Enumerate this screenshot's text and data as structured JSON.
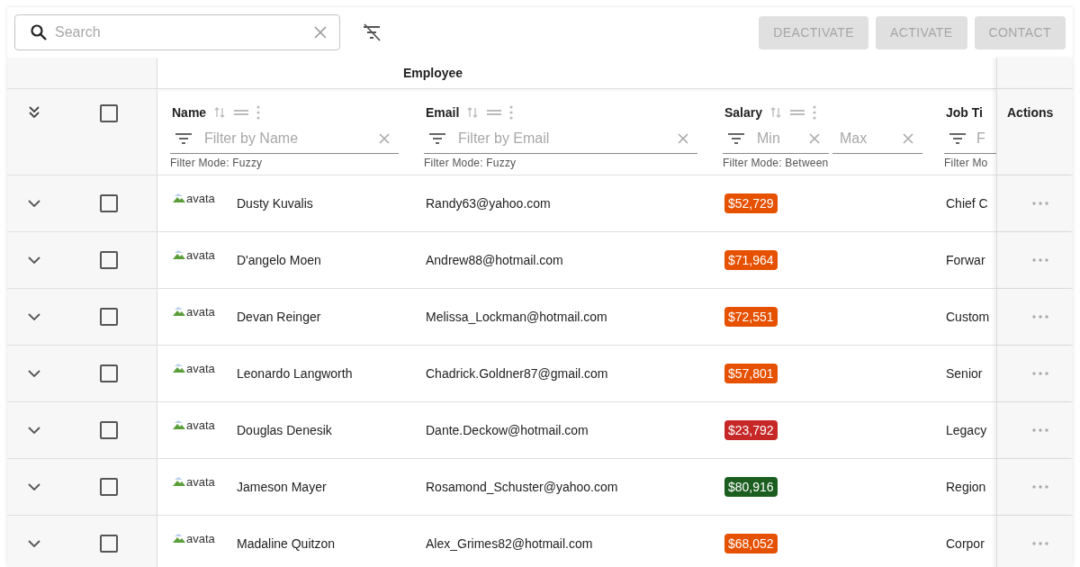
{
  "search": {
    "placeholder": "Search"
  },
  "toolbar_buttons": [
    {
      "label": "DEACTIVATE",
      "disabled": true
    },
    {
      "label": "ACTIVATE",
      "disabled": true
    },
    {
      "label": "CONTACT",
      "disabled": true
    }
  ],
  "column_group": {
    "label": "Employee"
  },
  "columns": [
    {
      "kind": "text",
      "label": "Name",
      "filter_placeholder": "Filter by Name",
      "filter_mode": "Filter Mode: Fuzzy"
    },
    {
      "kind": "text",
      "label": "Email",
      "filter_placeholder": "Filter by Email",
      "filter_mode": "Filter Mode: Fuzzy"
    },
    {
      "kind": "range",
      "label": "Salary",
      "min_placeholder": "Min",
      "max_placeholder": "Max",
      "filter_mode": "Filter Mode: Between"
    },
    {
      "kind": "covered",
      "label": "Job Ti",
      "filter_placeholder": "F",
      "filter_mode": "Filter Mo"
    }
  ],
  "actions_header": "Actions",
  "select_all": {
    "checked": false
  },
  "rows": [
    {
      "avatar_alt": "avata",
      "name": "Dusty Kuvalis",
      "email": "Randy63@yahoo.com",
      "salary": "$52,729",
      "color": "#e65100",
      "job_title": "Chief C",
      "checked": false
    },
    {
      "avatar_alt": "avata",
      "name": "D'angelo Moen",
      "email": "Andrew88@hotmail.com",
      "salary": "$71,964",
      "color": "#e65100",
      "job_title": "Forwar",
      "checked": false
    },
    {
      "avatar_alt": "avata",
      "name": "Devan Reinger",
      "email": "Melissa_Lockman@hotmail.com",
      "salary": "$72,551",
      "color": "#e65100",
      "job_title": "Custom",
      "checked": false
    },
    {
      "avatar_alt": "avata",
      "name": "Leonardo Langworth",
      "email": "Chadrick.Goldner87@gmail.com",
      "salary": "$57,801",
      "color": "#e65100",
      "job_title": "Senior",
      "checked": false
    },
    {
      "avatar_alt": "avata",
      "name": "Douglas Denesik",
      "email": "Dante.Deckow@hotmail.com",
      "salary": "$23,792",
      "color": "#c62828",
      "job_title": "Legacy",
      "checked": false
    },
    {
      "avatar_alt": "avata",
      "name": "Jameson Mayer",
      "email": "Rosamond_Schuster@yahoo.com",
      "salary": "$80,916",
      "color": "#1b5e20",
      "job_title": "Region",
      "checked": false
    },
    {
      "avatar_alt": "avata",
      "name": "Madaline Quitzon",
      "email": "Alex_Grimes82@hotmail.com",
      "salary": "$68,052",
      "color": "#e65100",
      "job_title": "Corpor",
      "checked": false
    }
  ]
}
